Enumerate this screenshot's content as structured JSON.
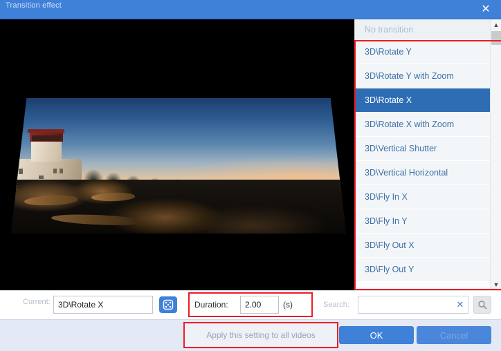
{
  "window": {
    "title": "Transition effect",
    "close_icon": "close-icon"
  },
  "preview": {
    "description": "Lighthouse on rocky coast at sunset, shown with 3D rotate-X perspective transition"
  },
  "transition_list": {
    "header": "No transition",
    "items": [
      {
        "label": "3D\\Rotate Y",
        "selected": false
      },
      {
        "label": "3D\\Rotate Y with Zoom",
        "selected": false
      },
      {
        "label": "3D\\Rotate X",
        "selected": true
      },
      {
        "label": "3D\\Rotate X with Zoom",
        "selected": false
      },
      {
        "label": "3D\\Vertical Shutter",
        "selected": false
      },
      {
        "label": "3D\\Vertical Horizontal",
        "selected": false
      },
      {
        "label": "3D\\Fly In X",
        "selected": false
      },
      {
        "label": "3D\\Fly In Y",
        "selected": false
      },
      {
        "label": "3D\\Fly Out X",
        "selected": false
      },
      {
        "label": "3D\\Fly Out Y",
        "selected": false
      }
    ],
    "scroll_up_icon": "chevron-up-icon",
    "scroll_down_icon": "chevron-down-icon"
  },
  "controls": {
    "current_label": "Current:",
    "current_value": "3D\\Rotate X",
    "random_icon": "dice-icon",
    "duration_label": "Duration:",
    "duration_value": "2.00",
    "duration_unit": "(s)",
    "search_label": "Search:",
    "search_value": "",
    "search_placeholder": "",
    "clear_icon": "close-x-icon",
    "search_icon": "search-icon"
  },
  "footer": {
    "apply_all_label": "Apply this setting to all videos",
    "ok_label": "OK",
    "cancel_label": "Cancel"
  },
  "colors": {
    "titlebar": "#3f80d8",
    "selected_item": "#2e6db4",
    "accent_button": "#3f80d8",
    "annotation_red": "#ee1c25",
    "footer_bg": "#e3e9f5",
    "list_text": "#3c6fa8"
  }
}
